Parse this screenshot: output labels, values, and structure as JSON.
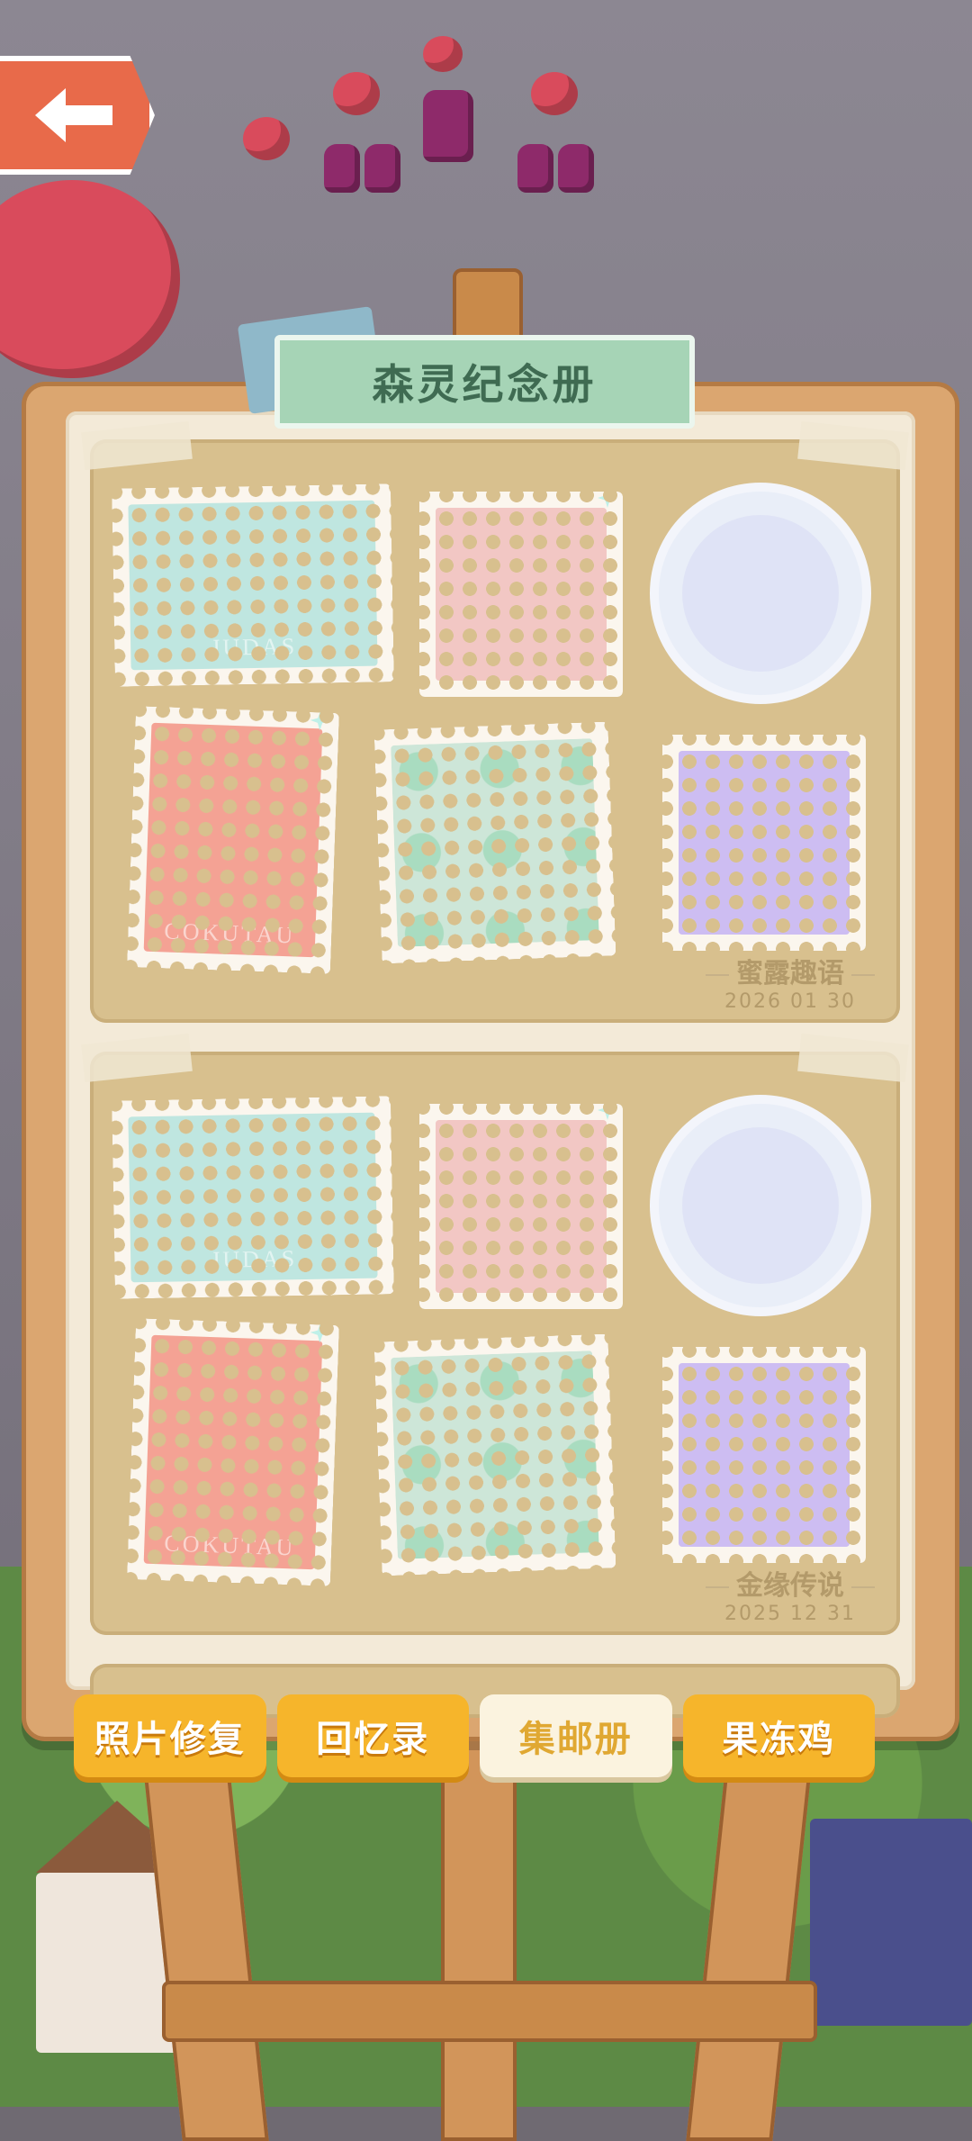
{
  "album": {
    "title": "森灵纪念册"
  },
  "sections": [
    {
      "caption_title": "蜜露趣语",
      "caption_date": "2026 01 30",
      "stamps": [
        {
          "name": "honey-fountain-stamp",
          "bg": "#bfe6e0",
          "watermark": "JUDAS"
        },
        {
          "name": "honey-cookie-stamp",
          "bg": "#f2c7c4",
          "watermark": ""
        },
        {
          "name": "honey-cart-stamp",
          "bg": "#dfe3f6",
          "watermark": ""
        },
        {
          "name": "fluffy-cookie-stamp",
          "bg": "#f4a294",
          "watermark": "COKUTAU"
        },
        {
          "name": "empty-stamp-slot",
          "bg": "#cde6d8",
          "watermark": ""
        },
        {
          "name": "bee-costume-stamp",
          "bg": "#cdbdf2",
          "watermark": ""
        }
      ]
    },
    {
      "caption_title": "金缘传说",
      "caption_date": "2025 12 31",
      "stamps": [
        {
          "name": "moon-tower-stamp",
          "bg": "#bfe6e0",
          "watermark": "JUDAS"
        },
        {
          "name": "boy-cookie-stamp",
          "bg": "#f2c7c4",
          "watermark": ""
        },
        {
          "name": "lotus-vase-stamp",
          "bg": "#dfe3f6",
          "watermark": ""
        },
        {
          "name": "blonde-girl-stamp",
          "bg": "#f4a294",
          "watermark": "COKUTAU"
        },
        {
          "name": "empty-stamp-slot",
          "bg": "#cde6d8",
          "watermark": ""
        },
        {
          "name": "leaf-bird-stamp",
          "bg": "#cdbdf2",
          "watermark": ""
        }
      ]
    }
  ],
  "tabs": [
    {
      "label": "照片修复",
      "active": false
    },
    {
      "label": "回忆录",
      "active": false
    },
    {
      "label": "集邮册",
      "active": true
    },
    {
      "label": "果冻鸡",
      "active": false
    }
  ],
  "icons": {
    "back": "arrow-left-icon"
  },
  "colors": {
    "accent_tab": "#f6b52b",
    "title_green": "#a6d4b6",
    "back_button": "#e86a4a"
  }
}
